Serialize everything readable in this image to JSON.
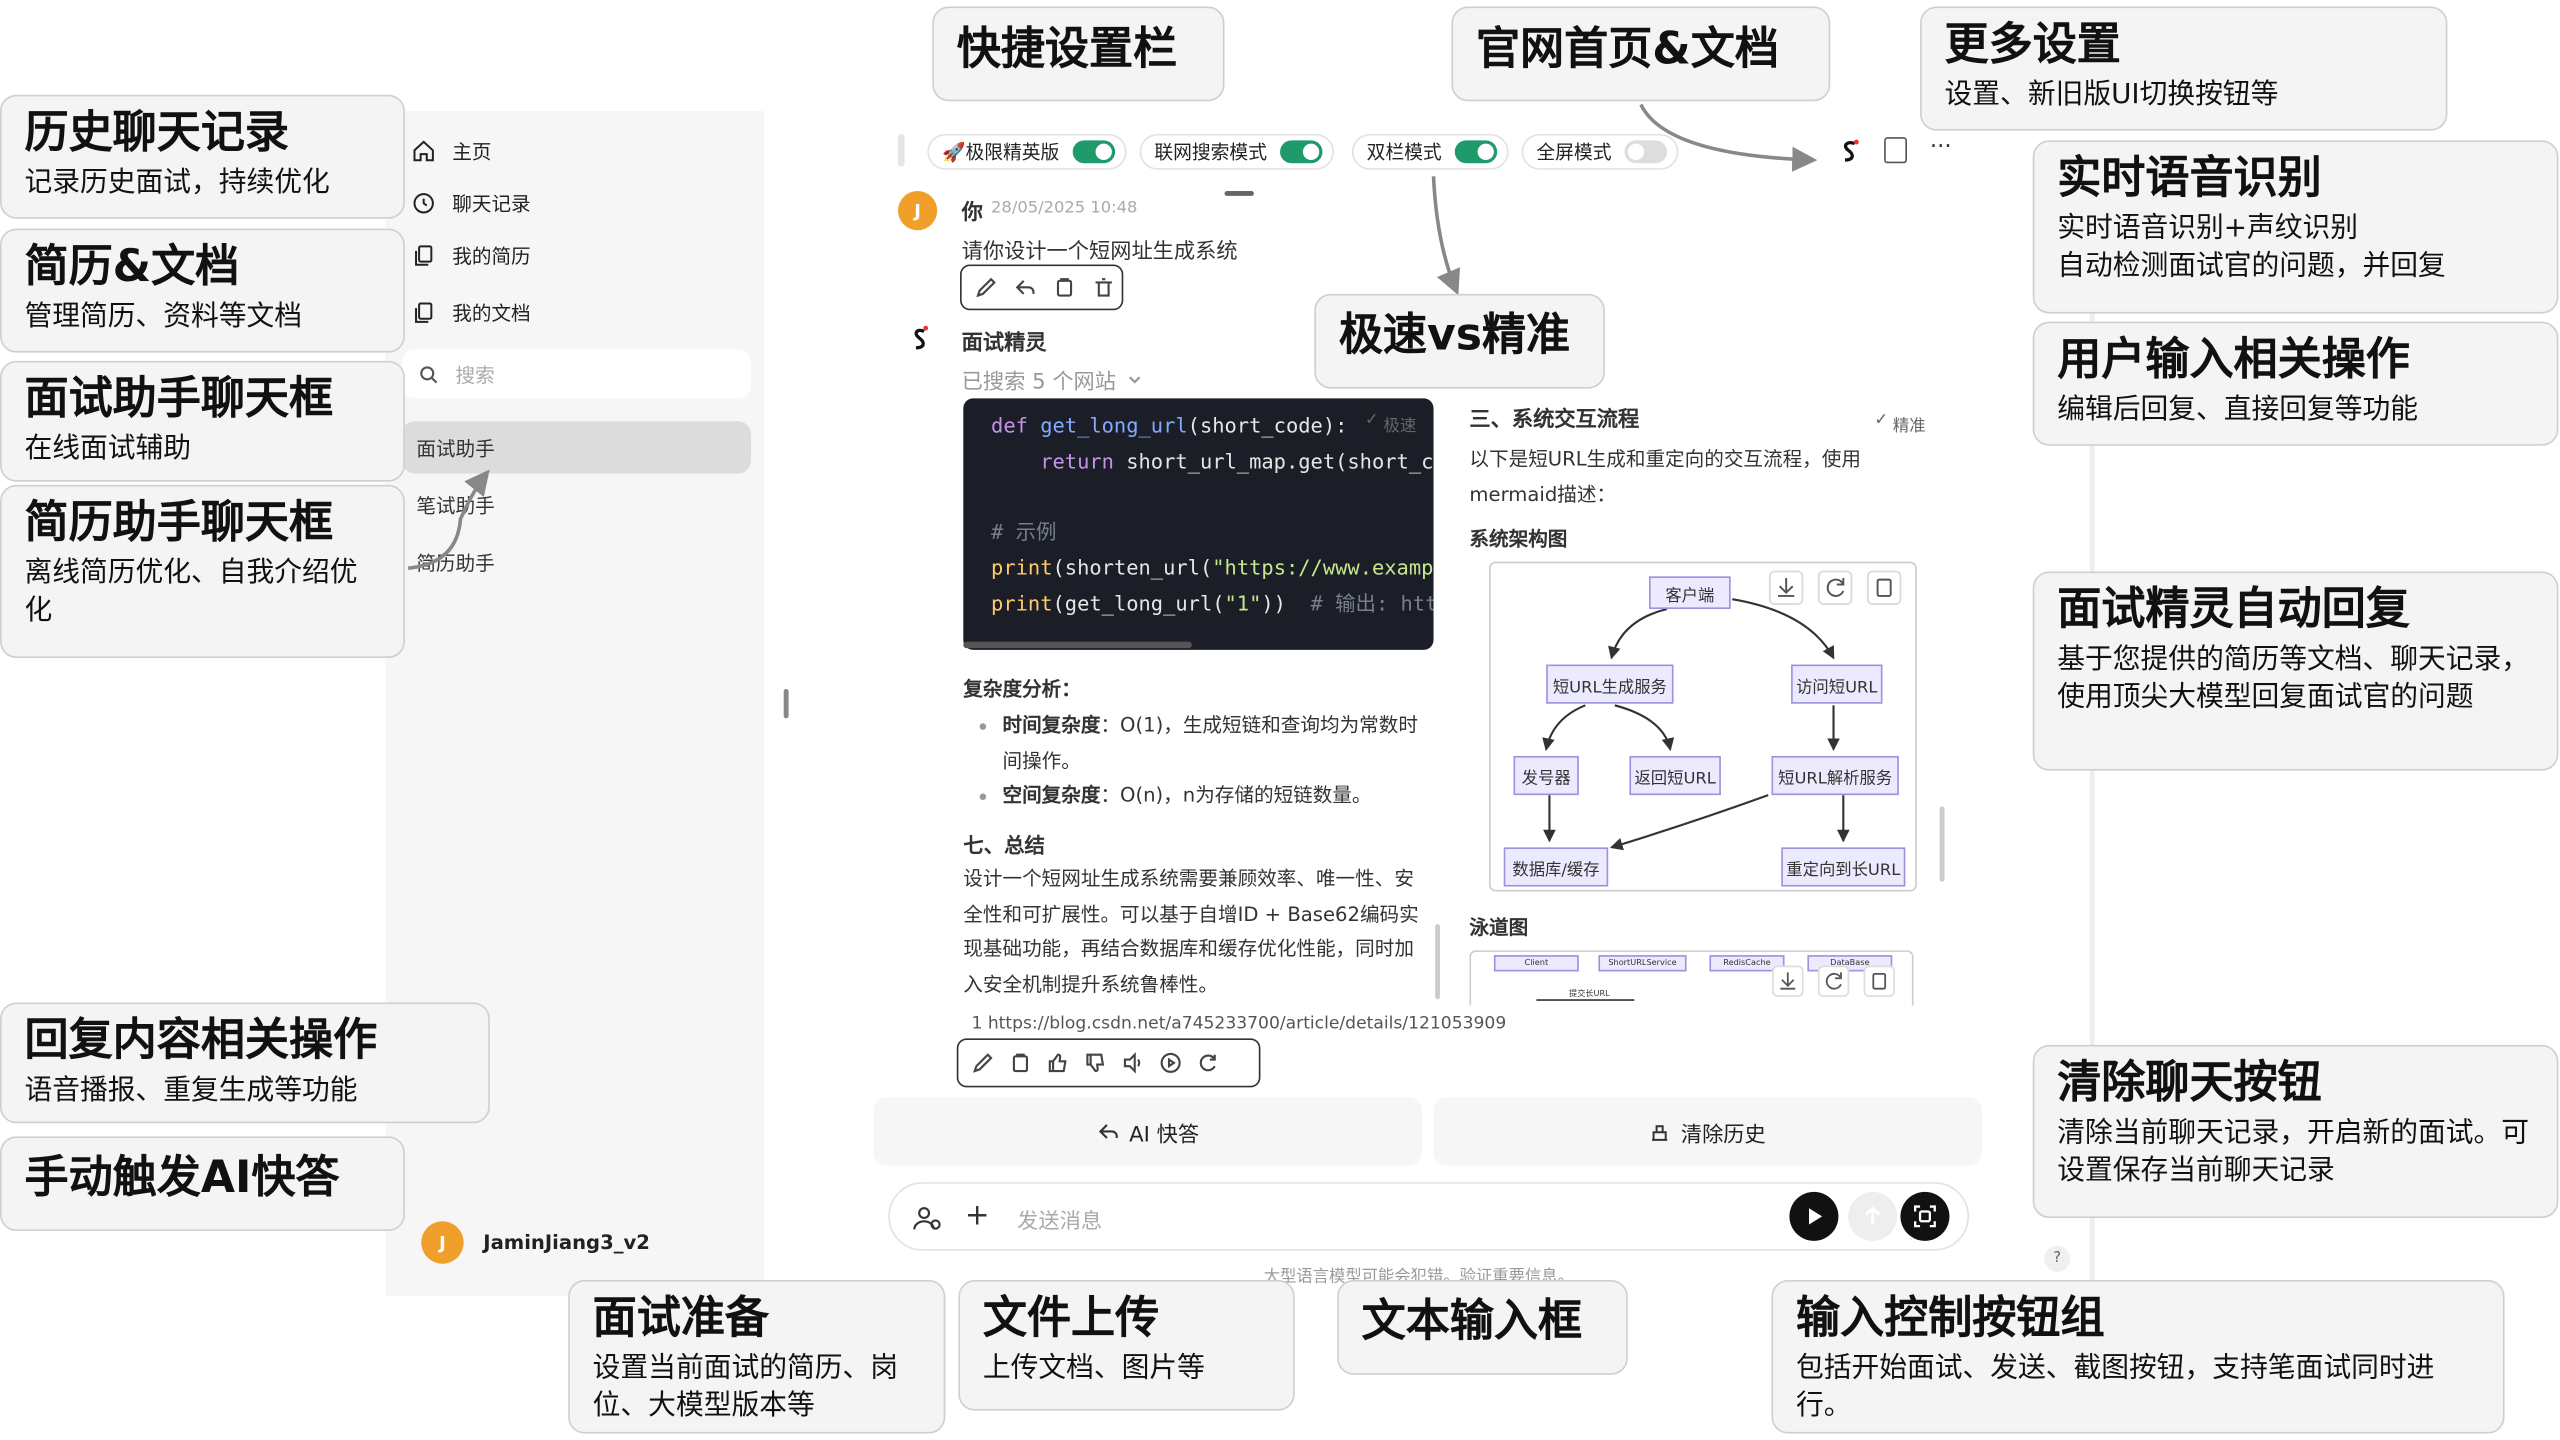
{
  "sidebar": {
    "nav": [
      {
        "label": "主页",
        "icon": "home-icon"
      },
      {
        "label": "聊天记录",
        "icon": "chat-history-icon"
      },
      {
        "label": "我的简历",
        "icon": "resume-icon"
      },
      {
        "label": "我的文档",
        "icon": "document-icon"
      }
    ],
    "search_placeholder": "搜索",
    "assistants": [
      "面试助手",
      "笔试助手",
      "简历助手"
    ],
    "selected_assistant": "面试助手",
    "user": {
      "avatar_letter": "J",
      "name": "JaminJiang3_v2"
    }
  },
  "toolbar": {
    "toggles": [
      {
        "label": "🚀极限精英版",
        "on": true
      },
      {
        "label": "联网搜索模式",
        "on": true
      },
      {
        "label": "双栏模式",
        "on": true
      },
      {
        "label": "全屏模式",
        "on": false
      }
    ],
    "icons": [
      "logo-icon",
      "docs-icon",
      "more-icon"
    ],
    "more_label": "···"
  },
  "chat": {
    "user_msg": {
      "avatar_letter": "J",
      "sender": "你",
      "time": "28/05/2025 10:48",
      "text": "请你设计一个短网址生成系统"
    },
    "assistant": {
      "name": "面试精灵",
      "searched": "已搜索 5 个网站",
      "left_badge": "极速",
      "right_badge": "精准",
      "code_lines": [
        "def get_long_url(short_code):",
        "    return short_url_map.get(short_c",
        "",
        "# 示例",
        "print(shorten_url(\"https://www.examp",
        "print(get_long_url(\"1\"))  # 输出: htt"
      ],
      "complexity_title": "复杂度分析：",
      "complexity": [
        {
          "label": "时间复杂度",
          "text": "：O(1)，生成短链和查询均为常数时",
          "text2": "间操作。"
        },
        {
          "label": "空间复杂度",
          "text": "：O(n)，n为存储的短链数量。",
          "text2": ""
        }
      ],
      "summary_title": "七、总结",
      "summary_lines": [
        "设计一个短网址生成系统需要兼顾效率、唯一性、安",
        "全性和可扩展性。可以基于自增ID + Base62编码实",
        "现基础功能，再结合数据库和缓存优化性能，同时加",
        "入安全机制提升系统鲁棒性。"
      ],
      "right_title": "三、系统交互流程",
      "right_intro1": "以下是短URL生成和重定向的交互流程，使用",
      "right_intro2": "mermaid描述：",
      "diagram_title": "系统架构图",
      "nodes": [
        "客户端",
        "短URL生成服务",
        "访问短URL",
        "发号器",
        "返回短URL",
        "短URL解析服务",
        "数据库/缓存",
        "重定向到长URL"
      ],
      "swimlane_title": "泳道图",
      "swimlane_labels": [
        "Client",
        "ShortURLService",
        "RedisCache",
        "DataBase"
      ],
      "swimlane_row": "提交长URL",
      "citation": "1  https://blog.csdn.net/a745233700/article/details/121053909"
    }
  },
  "actions": {
    "quick_answer": "AI 快答",
    "clear_history": "清除历史"
  },
  "input": {
    "placeholder": "发送消息",
    "disclaimer": "大型语言模型可能会犯错。验证重要信息。",
    "help": "?"
  },
  "callouts": {
    "history": {
      "title": "历史聊天记录",
      "desc": "记录历史面试，持续优化"
    },
    "resume_docs": {
      "title": "简历&文档",
      "desc": "管理简历、资料等文档"
    },
    "interview_chat": {
      "title": "面试助手聊天框",
      "desc": "在线面试辅助"
    },
    "resume_chat": {
      "title": "简历助手聊天框",
      "desc": "离线简历优化、自我介绍优化"
    },
    "reply_ops": {
      "title": "回复内容相关操作",
      "desc": "语音播报、重复生成等功能"
    },
    "manual_ai": {
      "title": "手动触发AI快答",
      "desc": ""
    },
    "quick_settings": {
      "title": "快捷设置栏",
      "desc": ""
    },
    "website_docs": {
      "title": "官网首页&文档",
      "desc": ""
    },
    "more_settings": {
      "title": "更多设置",
      "desc": "设置、新旧版UI切换按钮等"
    },
    "speed_vs_precise": {
      "title": "极速vs精准",
      "desc": ""
    },
    "voice": {
      "title": "实时语音识别",
      "desc": "实时语音识别+声纹识别\n自动检测面试官的问题，并回复"
    },
    "user_input": {
      "title": "用户输入相关操作",
      "desc": "编辑后回复、直接回复等功能"
    },
    "auto_reply": {
      "title": "面试精灵自动回复",
      "desc": "基于您提供的简历等文档、聊天记录，使用顶尖大模型回复面试官的问题"
    },
    "clear_chat": {
      "title": "清除聊天按钮",
      "desc": "清除当前聊天记录，开启新的面试。可设置保存当前聊天记录"
    },
    "prep": {
      "title": "面试准备",
      "desc": "设置当前面试的简历、岗位、大模型版本等"
    },
    "upload": {
      "title": "文件上传",
      "desc": "上传文档、图片等"
    },
    "text_input": {
      "title": "文本输入框",
      "desc": ""
    },
    "input_controls": {
      "title": "输入控制按钮组",
      "desc": "包括开始面试、发送、截图按钮，支持笔面试同时进行。"
    }
  }
}
